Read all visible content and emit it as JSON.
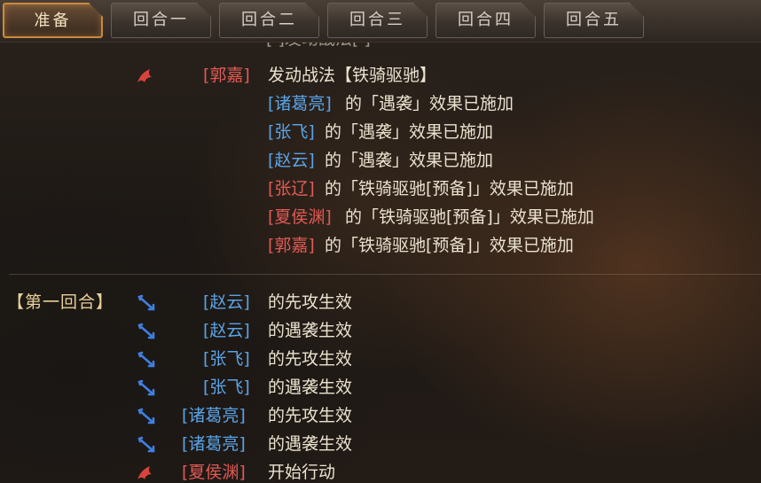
{
  "tabs": [
    "准备",
    "回合一",
    "回合二",
    "回合三",
    "回合四",
    "回合五"
  ],
  "active_tab": 0,
  "log": {
    "top_partial": "[ ]发动战法[ ]",
    "prep": [
      {
        "prefix": "",
        "name": "[郭嘉]",
        "side": "red",
        "text": "发动战法【铁骑驱驰】",
        "icon": "red-cavalry-icon"
      },
      {
        "prefix": "",
        "name": "[诸葛亮]",
        "side": "blue",
        "text": "的「遇袭」效果已施加"
      },
      {
        "prefix": "",
        "name": "[张飞]",
        "side": "blue",
        "text": "的「遇袭」效果已施加"
      },
      {
        "prefix": "",
        "name": "[赵云]",
        "side": "blue",
        "text": "的「遇袭」效果已施加"
      },
      {
        "prefix": "",
        "name": "[张辽]",
        "side": "red",
        "text": "的「铁骑驱驰[预备]」效果已施加"
      },
      {
        "prefix": "",
        "name": "[夏侯渊]",
        "side": "red",
        "text": "的「铁骑驱驰[预备]」效果已施加"
      },
      {
        "prefix": "",
        "name": "[郭嘉]",
        "side": "red",
        "text": "的「铁骑驱驰[预备]」效果已施加"
      }
    ],
    "round_label": "【第一回合】",
    "round1": [
      {
        "name": "[赵云]",
        "side": "blue",
        "text": "的先攻生效"
      },
      {
        "name": "[赵云]",
        "side": "blue",
        "text": "的遇袭生效"
      },
      {
        "name": "[张飞]",
        "side": "blue",
        "text": "的先攻生效"
      },
      {
        "name": "[张飞]",
        "side": "blue",
        "text": "的遇袭生效"
      },
      {
        "name": "[诸葛亮]",
        "side": "blue",
        "text": "的先攻生效"
      },
      {
        "name": "[诸葛亮]",
        "side": "blue",
        "text": "的遇袭生效"
      },
      {
        "name": "[夏侯渊]",
        "side": "red",
        "text": "开始行动"
      }
    ]
  },
  "colors": {
    "blue_name": "#5aa3e6",
    "red_name": "#e05a55",
    "active_tab_border": "#c98a3e",
    "round_label": "#e8cf9a"
  }
}
